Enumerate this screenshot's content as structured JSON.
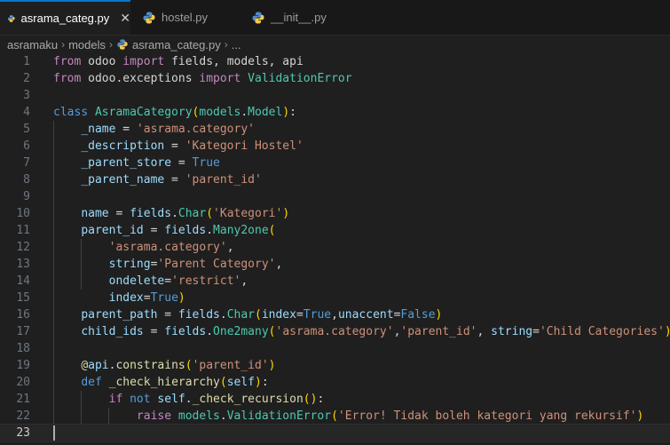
{
  "tabs": [
    {
      "label": "asrama_categ.py",
      "active": true,
      "close": "✕"
    },
    {
      "label": "hostel.py",
      "active": false
    },
    {
      "label": "__init__.py",
      "active": false
    }
  ],
  "breadcrumb": {
    "items": [
      "asramaku",
      "models",
      "asrama_categ.py",
      "..."
    ],
    "separator": "›"
  },
  "editor": {
    "current_line": 23,
    "line_numbers": [
      "1",
      "2",
      "3",
      "4",
      "5",
      "6",
      "7",
      "8",
      "9",
      "10",
      "11",
      "12",
      "13",
      "14",
      "15",
      "16",
      "17",
      "18",
      "19",
      "20",
      "21",
      "22",
      "23"
    ],
    "lines": [
      [
        {
          "t": "from",
          "c": "k"
        },
        {
          "t": " odoo ",
          "c": "t"
        },
        {
          "t": "import",
          "c": "k"
        },
        {
          "t": " fields, models, api",
          "c": "t"
        }
      ],
      [
        {
          "t": "from",
          "c": "k"
        },
        {
          "t": " odoo.exceptions ",
          "c": "t"
        },
        {
          "t": "import",
          "c": "k"
        },
        {
          "t": " ",
          "c": "t"
        },
        {
          "t": "ValidationError",
          "c": "c"
        }
      ],
      [],
      [
        {
          "t": "class",
          "c": "d"
        },
        {
          "t": " ",
          "c": "t"
        },
        {
          "t": "AsramaCategory",
          "c": "c"
        },
        {
          "t": "(",
          "c": "b1"
        },
        {
          "t": "models",
          "c": "c"
        },
        {
          "t": ".",
          "c": "t"
        },
        {
          "t": "Model",
          "c": "c"
        },
        {
          "t": ")",
          "c": "b1"
        },
        {
          "t": ":",
          "c": "t"
        }
      ],
      [
        {
          "t": "    ",
          "c": "t"
        },
        {
          "t": "_name",
          "c": "v"
        },
        {
          "t": " = ",
          "c": "t"
        },
        {
          "t": "'asrama.category'",
          "c": "s"
        }
      ],
      [
        {
          "t": "    ",
          "c": "t"
        },
        {
          "t": "_description",
          "c": "v"
        },
        {
          "t": " = ",
          "c": "t"
        },
        {
          "t": "'Kategori Hostel'",
          "c": "s"
        }
      ],
      [
        {
          "t": "    ",
          "c": "t"
        },
        {
          "t": "_parent_store",
          "c": "v"
        },
        {
          "t": " = ",
          "c": "t"
        },
        {
          "t": "True",
          "c": "d"
        }
      ],
      [
        {
          "t": "    ",
          "c": "t"
        },
        {
          "t": "_parent_name",
          "c": "v"
        },
        {
          "t": " = ",
          "c": "t"
        },
        {
          "t": "'parent_id'",
          "c": "s"
        }
      ],
      [],
      [
        {
          "t": "    ",
          "c": "t"
        },
        {
          "t": "name",
          "c": "v"
        },
        {
          "t": " = ",
          "c": "t"
        },
        {
          "t": "fields",
          "c": "v"
        },
        {
          "t": ".",
          "c": "t"
        },
        {
          "t": "Char",
          "c": "c"
        },
        {
          "t": "(",
          "c": "b1"
        },
        {
          "t": "'Kategori'",
          "c": "s"
        },
        {
          "t": ")",
          "c": "b1"
        }
      ],
      [
        {
          "t": "    ",
          "c": "t"
        },
        {
          "t": "parent_id",
          "c": "v"
        },
        {
          "t": " = ",
          "c": "t"
        },
        {
          "t": "fields",
          "c": "v"
        },
        {
          "t": ".",
          "c": "t"
        },
        {
          "t": "Many2one",
          "c": "c"
        },
        {
          "t": "(",
          "c": "b1"
        }
      ],
      [
        {
          "t": "        ",
          "c": "t"
        },
        {
          "t": "'asrama.category'",
          "c": "s"
        },
        {
          "t": ",",
          "c": "t"
        }
      ],
      [
        {
          "t": "        ",
          "c": "t"
        },
        {
          "t": "string",
          "c": "v"
        },
        {
          "t": "=",
          "c": "t"
        },
        {
          "t": "'Parent Category'",
          "c": "s"
        },
        {
          "t": ",",
          "c": "t"
        }
      ],
      [
        {
          "t": "        ",
          "c": "t"
        },
        {
          "t": "ondelete",
          "c": "v"
        },
        {
          "t": "=",
          "c": "t"
        },
        {
          "t": "'restrict'",
          "c": "s"
        },
        {
          "t": ",",
          "c": "t"
        }
      ],
      [
        {
          "t": "        ",
          "c": "t"
        },
        {
          "t": "index",
          "c": "v"
        },
        {
          "t": "=",
          "c": "t"
        },
        {
          "t": "True",
          "c": "d"
        },
        {
          "t": ")",
          "c": "b1"
        }
      ],
      [
        {
          "t": "    ",
          "c": "t"
        },
        {
          "t": "parent_path",
          "c": "v"
        },
        {
          "t": " = ",
          "c": "t"
        },
        {
          "t": "fields",
          "c": "v"
        },
        {
          "t": ".",
          "c": "t"
        },
        {
          "t": "Char",
          "c": "c"
        },
        {
          "t": "(",
          "c": "b1"
        },
        {
          "t": "index",
          "c": "v"
        },
        {
          "t": "=",
          "c": "t"
        },
        {
          "t": "True",
          "c": "d"
        },
        {
          "t": ",",
          "c": "t"
        },
        {
          "t": "unaccent",
          "c": "v"
        },
        {
          "t": "=",
          "c": "t"
        },
        {
          "t": "False",
          "c": "d"
        },
        {
          "t": ")",
          "c": "b1"
        }
      ],
      [
        {
          "t": "    ",
          "c": "t"
        },
        {
          "t": "child_ids",
          "c": "v"
        },
        {
          "t": " = ",
          "c": "t"
        },
        {
          "t": "fields",
          "c": "v"
        },
        {
          "t": ".",
          "c": "t"
        },
        {
          "t": "One2many",
          "c": "c"
        },
        {
          "t": "(",
          "c": "b1"
        },
        {
          "t": "'asrama.category'",
          "c": "s"
        },
        {
          "t": ",",
          "c": "t"
        },
        {
          "t": "'parent_id'",
          "c": "s"
        },
        {
          "t": ", ",
          "c": "t"
        },
        {
          "t": "string",
          "c": "v"
        },
        {
          "t": "=",
          "c": "t"
        },
        {
          "t": "'Child Categories'",
          "c": "s"
        },
        {
          "t": ")",
          "c": "b1"
        }
      ],
      [],
      [
        {
          "t": "    ",
          "c": "t"
        },
        {
          "t": "@",
          "c": "f"
        },
        {
          "t": "api",
          "c": "v"
        },
        {
          "t": ".",
          "c": "t"
        },
        {
          "t": "constrains",
          "c": "f"
        },
        {
          "t": "(",
          "c": "b1"
        },
        {
          "t": "'parent_id'",
          "c": "s"
        },
        {
          "t": ")",
          "c": "b1"
        }
      ],
      [
        {
          "t": "    ",
          "c": "t"
        },
        {
          "t": "def",
          "c": "d"
        },
        {
          "t": " ",
          "c": "t"
        },
        {
          "t": "_check_hierarchy",
          "c": "f"
        },
        {
          "t": "(",
          "c": "b1"
        },
        {
          "t": "self",
          "c": "v"
        },
        {
          "t": ")",
          "c": "b1"
        },
        {
          "t": ":",
          "c": "t"
        }
      ],
      [
        {
          "t": "        ",
          "c": "t"
        },
        {
          "t": "if",
          "c": "k"
        },
        {
          "t": " ",
          "c": "t"
        },
        {
          "t": "not",
          "c": "d"
        },
        {
          "t": " ",
          "c": "t"
        },
        {
          "t": "self",
          "c": "v"
        },
        {
          "t": ".",
          "c": "t"
        },
        {
          "t": "_check_recursion",
          "c": "f"
        },
        {
          "t": "(",
          "c": "b1"
        },
        {
          "t": ")",
          "c": "b1"
        },
        {
          "t": ":",
          "c": "t"
        }
      ],
      [
        {
          "t": "            ",
          "c": "t"
        },
        {
          "t": "raise",
          "c": "k"
        },
        {
          "t": " ",
          "c": "t"
        },
        {
          "t": "models",
          "c": "c"
        },
        {
          "t": ".",
          "c": "t"
        },
        {
          "t": "ValidationError",
          "c": "c"
        },
        {
          "t": "(",
          "c": "b1"
        },
        {
          "t": "'Error! Tidak boleh kategori yang rekursif'",
          "c": "s"
        },
        {
          "t": ")",
          "c": "b1"
        }
      ],
      []
    ]
  }
}
